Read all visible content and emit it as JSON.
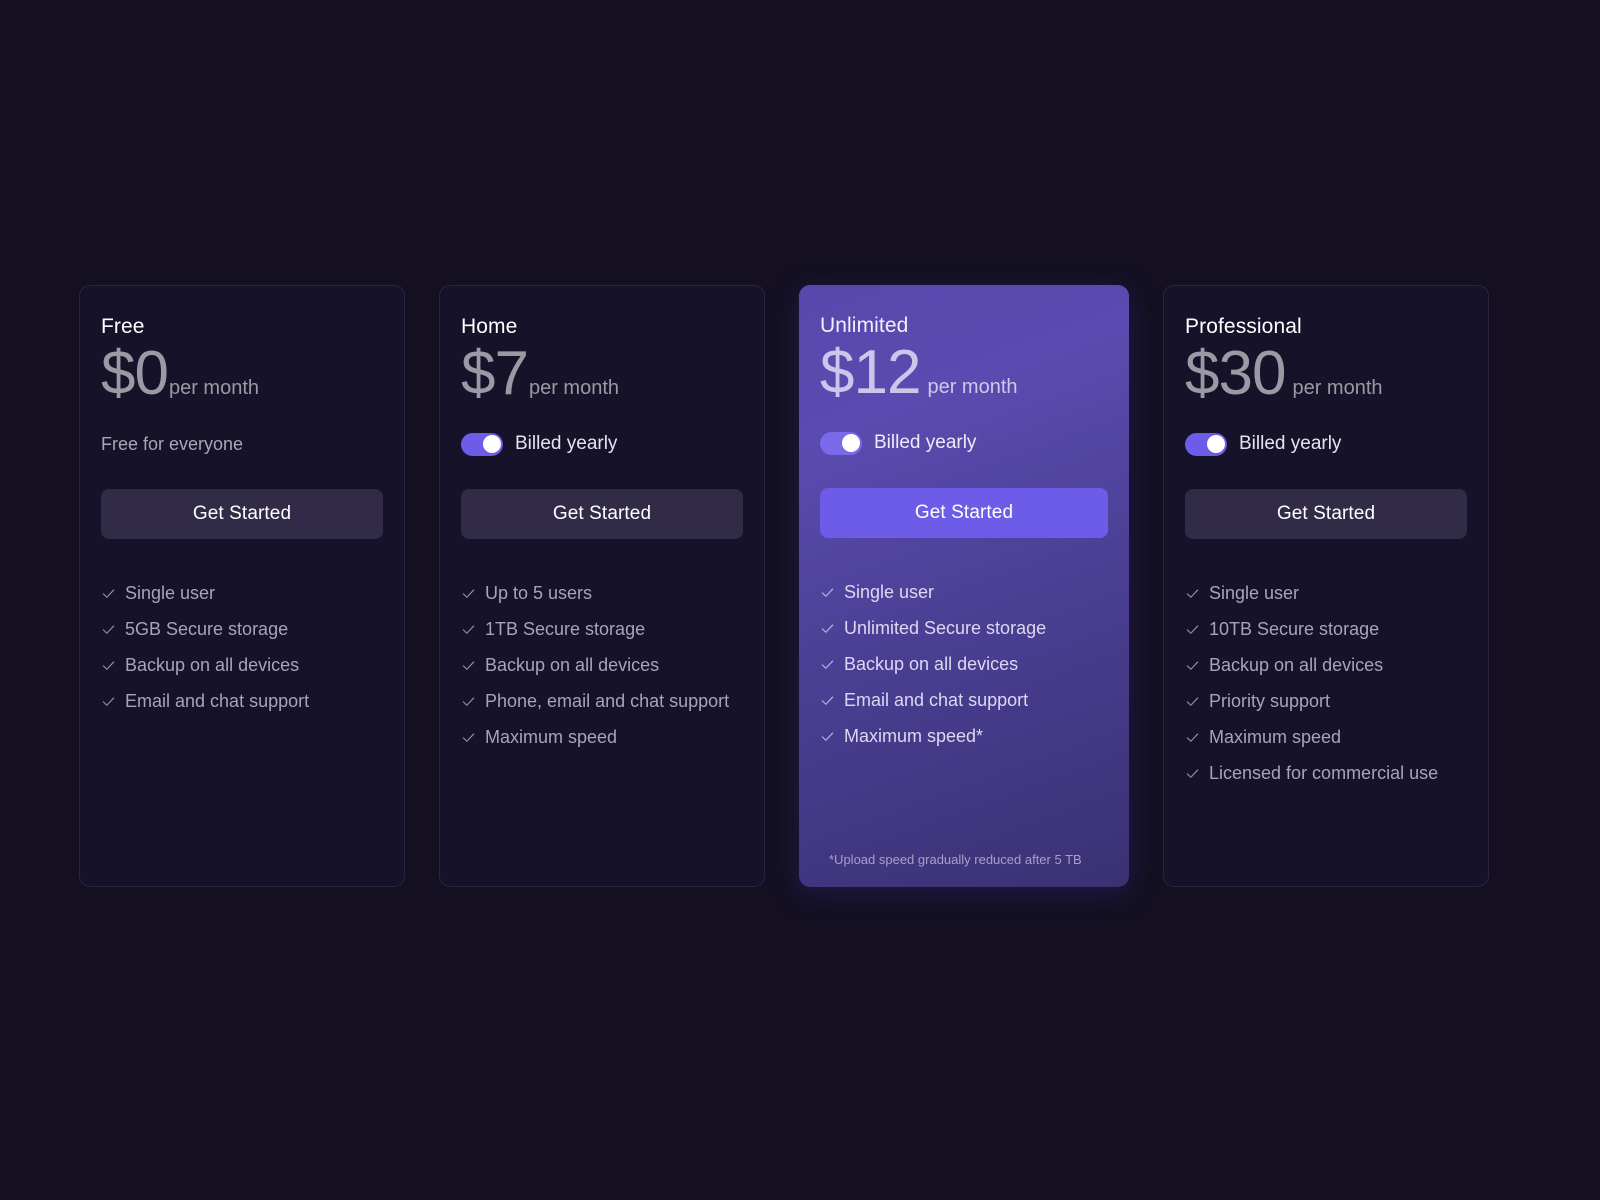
{
  "theme": {
    "page_background": "#141022",
    "card_background": "#16122a",
    "card_border": "#2a2440",
    "accent_purple": "#6c5ce7",
    "featured_gradient_from": "#5848ac",
    "featured_gradient_to": "#3a3173",
    "button_dark": "#322b47",
    "text_muted": "#a7a4b8",
    "text_bright": "#ffffff"
  },
  "plans": [
    {
      "name": "Free",
      "price": "$0",
      "period": "per month",
      "sub_note": "Free for everyone",
      "has_toggle": false,
      "toggle_label": "",
      "toggle_on": false,
      "cta_label": "Get Started",
      "featured": false,
      "features": [
        "Single user",
        "5GB Secure storage",
        "Backup on all devices",
        "Email and chat support"
      ],
      "footnote": ""
    },
    {
      "name": "Home",
      "price": "$7",
      "period": "per month",
      "sub_note": "",
      "has_toggle": true,
      "toggle_label": "Billed yearly",
      "toggle_on": true,
      "cta_label": "Get Started",
      "featured": false,
      "features": [
        "Up to 5 users",
        "1TB Secure storage",
        "Backup on all devices",
        "Phone, email and chat support",
        "Maximum speed"
      ],
      "footnote": ""
    },
    {
      "name": "Unlimited",
      "price": "$12",
      "period": "per month",
      "sub_note": "",
      "has_toggle": true,
      "toggle_label": "Billed yearly",
      "toggle_on": true,
      "cta_label": "Get Started",
      "featured": true,
      "features": [
        "Single user",
        "Unlimited Secure storage",
        "Backup on all devices",
        "Email and chat support",
        "Maximum speed*"
      ],
      "footnote": "*Upload speed gradually reduced after 5 TB"
    },
    {
      "name": "Professional",
      "price": "$30",
      "period": "per month",
      "sub_note": "",
      "has_toggle": true,
      "toggle_label": "Billed yearly",
      "toggle_on": true,
      "cta_label": "Get Started",
      "featured": false,
      "features": [
        "Single user",
        "10TB Secure storage",
        "Backup on all devices",
        "Priority support",
        "Maximum speed",
        "Licensed for commercial use"
      ],
      "footnote": ""
    }
  ],
  "icons": {
    "check": "check-icon",
    "toggle_knob": "toggle-knob"
  }
}
